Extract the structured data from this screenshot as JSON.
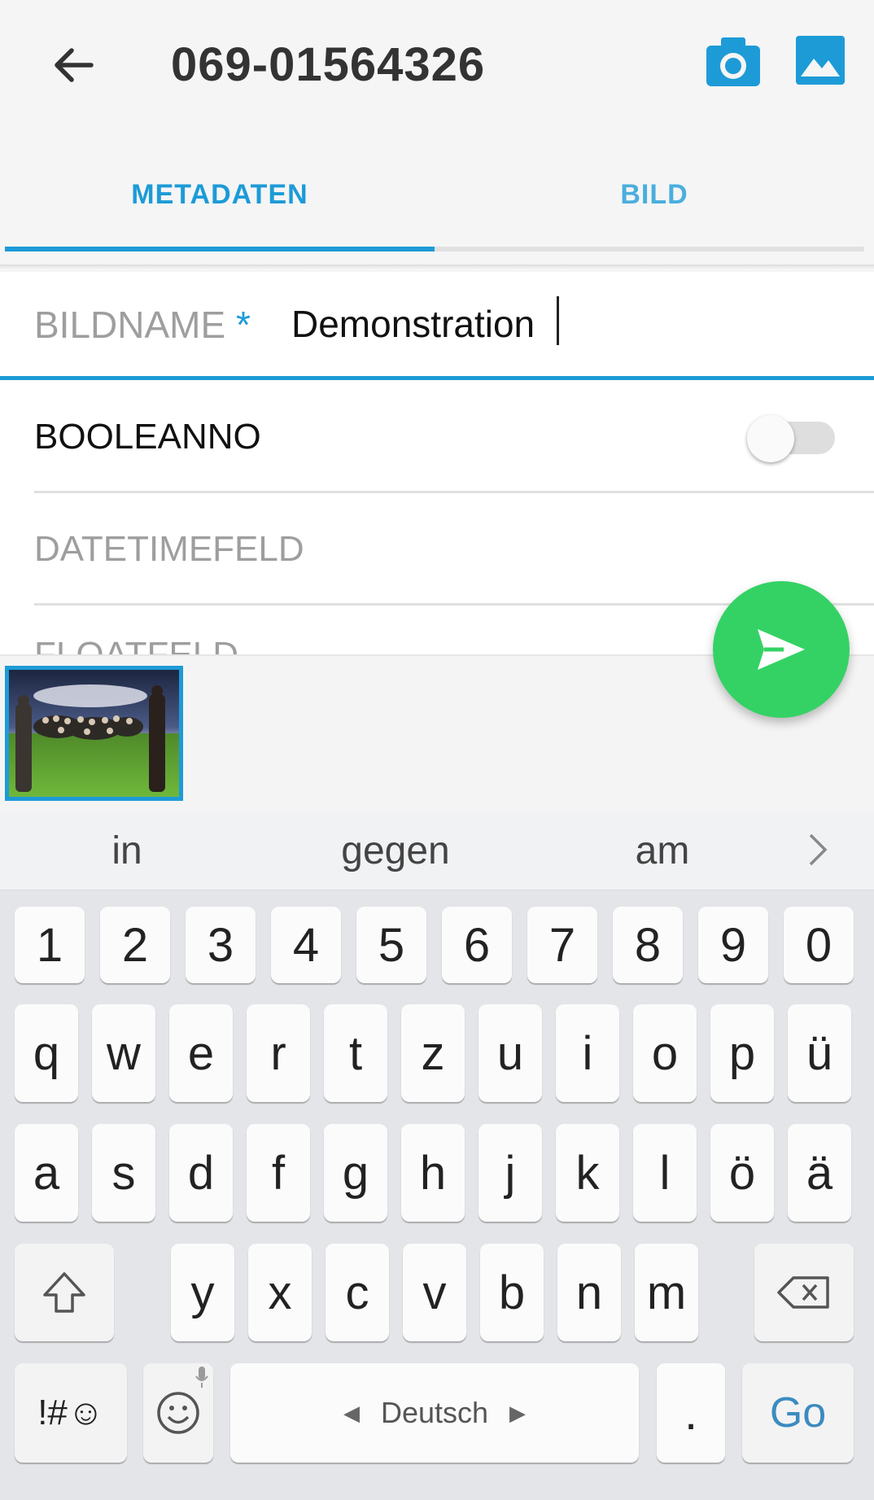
{
  "appbar": {
    "title": "069-01564326"
  },
  "tabs": [
    {
      "label": "METADATEN",
      "selected": true
    },
    {
      "label": "BILD",
      "selected": false
    }
  ],
  "form": {
    "bildname_label": "BILDNAME",
    "bildname_required": "*",
    "bildname_value": "Demonstration",
    "booleanno_label": "BOOLEANNO",
    "booleanno_on": false,
    "datetimefeld_label": "DATETIMEFELD",
    "floatfeld_label": "FLOATFELD"
  },
  "keyboard": {
    "suggestions": [
      "in",
      "gegen",
      "am"
    ],
    "row_numbers": [
      "1",
      "2",
      "3",
      "4",
      "5",
      "6",
      "7",
      "8",
      "9",
      "0"
    ],
    "row1": [
      "q",
      "w",
      "e",
      "r",
      "t",
      "z",
      "u",
      "i",
      "o",
      "p",
      "ü"
    ],
    "row2": [
      "a",
      "s",
      "d",
      "f",
      "g",
      "h",
      "j",
      "k",
      "l",
      "ö",
      "ä"
    ],
    "row3": [
      "y",
      "x",
      "c",
      "v",
      "b",
      "n",
      "m"
    ],
    "symbols_label": "!#☺",
    "space_label": "Deutsch",
    "period_label": ".",
    "go_label": "Go"
  },
  "colors": {
    "accent": "#1d9bd7",
    "fab": "#34d264",
    "go_text": "#3b8bc0"
  },
  "icons": [
    "arrow-back-icon",
    "camera-icon",
    "image-gallery-icon",
    "send-icon",
    "shift-icon",
    "backspace-icon",
    "emoji-icon",
    "microphone-icon",
    "chevron-right-icon"
  ]
}
